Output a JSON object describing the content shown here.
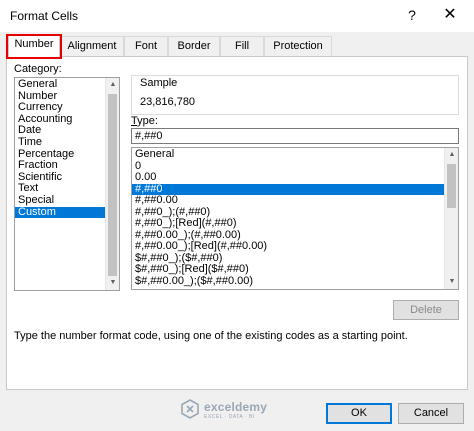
{
  "window": {
    "title": "Format Cells",
    "help_label": "?",
    "close_label": "✕"
  },
  "tabs": [
    {
      "label": "Number"
    },
    {
      "label": "Alignment"
    },
    {
      "label": "Font"
    },
    {
      "label": "Border"
    },
    {
      "label": "Fill"
    },
    {
      "label": "Protection"
    }
  ],
  "category": {
    "label": "Category:",
    "selected": "Custom",
    "items": [
      "General",
      "Number",
      "Currency",
      "Accounting",
      "Date",
      "Time",
      "Percentage",
      "Fraction",
      "Scientific",
      "Text",
      "Special",
      "Custom"
    ]
  },
  "sample": {
    "label": "Sample",
    "value": "23,816,780"
  },
  "type": {
    "label_prefix": "",
    "label_accel": "T",
    "label_rest": "ype:",
    "value": "#,##0",
    "selected": "#,##0",
    "items": [
      "General",
      "0",
      "0.00",
      "#,##0",
      "#,##0.00",
      "#,##0_);(#,##0)",
      "#,##0_);[Red](#,##0)",
      "#,##0.00_);(#,##0.00)",
      "#,##0.00_);[Red](#,##0.00)",
      "$#,##0_);($#,##0)",
      "$#,##0_);[Red]($#,##0)",
      "$#,##0.00_);($#,##0.00)"
    ]
  },
  "delete_label": "Delete",
  "description": "Type the number format code, using one of the existing codes as a starting point.",
  "watermark": {
    "name": "exceldemy",
    "tagline": "EXCEL · DATA · BI"
  },
  "buttons": {
    "ok": "OK",
    "cancel": "Cancel"
  },
  "colors": {
    "selection": "#0078d7",
    "tab_highlight": "#e60000"
  },
  "icons": {
    "watermark_logo": "exceldemy-logo-icon",
    "scroll_up": "scroll-up-arrow-icon",
    "scroll_down": "scroll-down-arrow-icon"
  }
}
